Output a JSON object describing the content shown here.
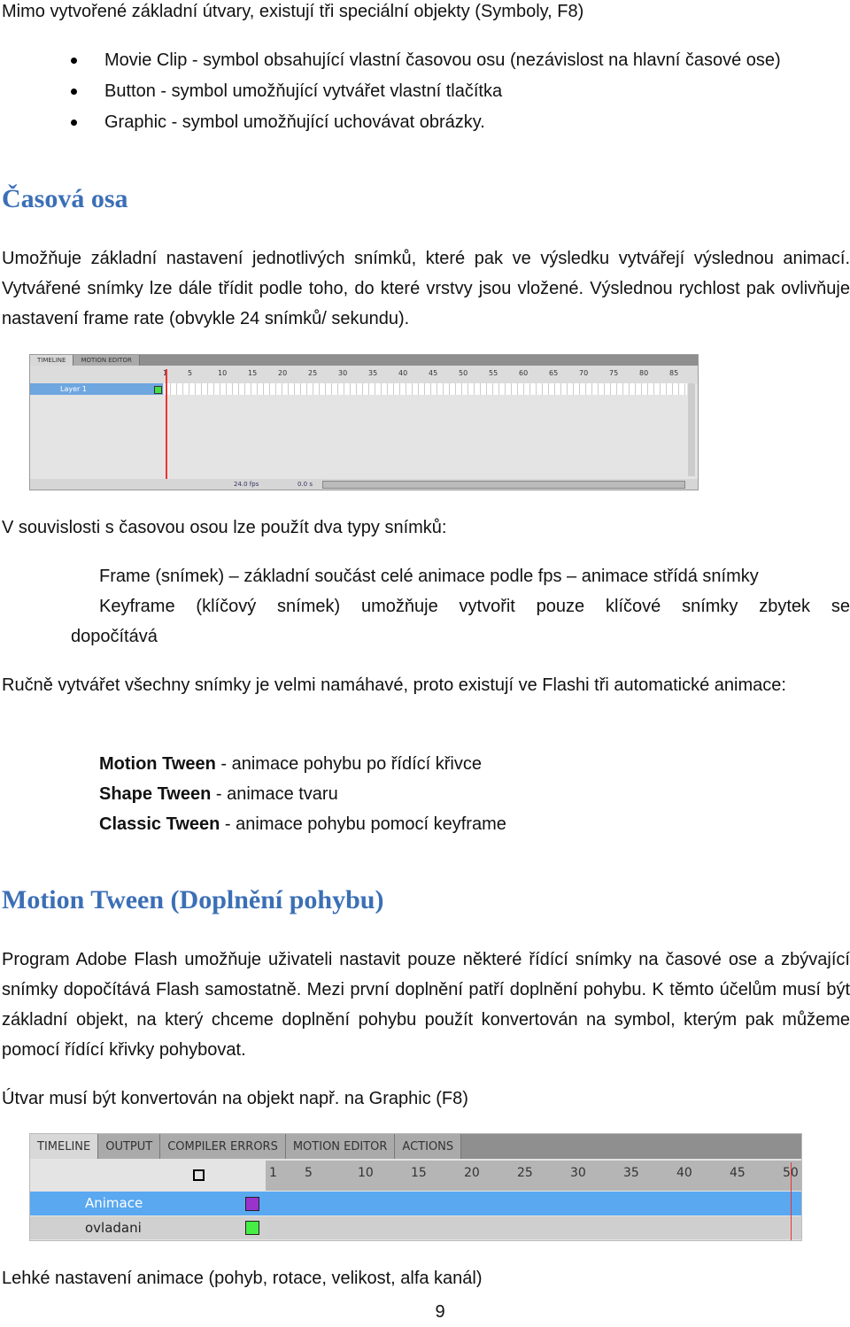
{
  "intro": "Mimo vytvořené základní útvary, existují tři speciální objekty (Symboly, F8)",
  "symbols": [
    "Movie Clip - symbol obsahující vlastní časovou osu (nezávislost na hlavní časové ose)",
    "Button - symbol umožňující vytvářet vlastní tlačítka",
    "Graphic  -  symbol umožňující uchovávat obrázky."
  ],
  "h1": "Časová osa",
  "p1": "Umožňuje základní nastavení jednotlivých snímků, které pak ve výsledku vytvářejí výslednou animací. Vytvářené snímky lze dále třídit podle toho, do které vrstvy jsou vložené. Výslednou rychlost pak ovlivňuje nastavení frame rate (obvykle 24 snímků/ sekundu).",
  "tl1": {
    "tabs": [
      "TIMELINE",
      "MOTION EDITOR"
    ],
    "frames": [
      "1",
      "5",
      "10",
      "15",
      "20",
      "25",
      "30",
      "35",
      "40",
      "45",
      "50",
      "55",
      "60",
      "65",
      "70",
      "75",
      "80",
      "85"
    ],
    "layer": "Layer 1",
    "fps": "24.0 fps",
    "time": "0.0 s",
    "frame": "1",
    "layer_color": "#44dd44"
  },
  "p2": "V souvislosti s časovou osou lze použít dva typy snímků:",
  "p3a": "Frame (snímek) – základní součást celé animace podle fps – animace střídá snímky",
  "p3b": "Keyframe (klíčový snímek) umožňuje vytvořit pouze klíčové snímky zbytek se",
  "p3c": "dopočítává",
  "p4": "Ručně vytvářet všechny snímky je velmi namáhavé, proto existují ve Flashi tři automatické animace:",
  "tweens": [
    {
      "name": "Motion Tween",
      "desc": " - animace pohybu po řídící křivce"
    },
    {
      "name": "Shape Tween",
      "desc": " - animace tvaru"
    },
    {
      "name": "Classic Tween",
      "desc": " - animace pohybu pomocí keyframe"
    }
  ],
  "h2": "Motion Tween (Doplnění pohybu)",
  "p5": "Program Adobe Flash umožňuje uživateli nastavit pouze některé řídící snímky na časové ose a zbývající snímky dopočítává Flash samostatně. Mezi první doplnění patří doplnění pohybu. K těmto účelům musí být základní objekt, na který chceme doplnění pohybu použít konvertován na symbol, kterým pak můžeme pomocí řídící křivky pohybovat.",
  "p6": "Útvar musí být konvertován na objekt např. na Graphic (F8)",
  "tl2": {
    "tabs": [
      "TIMELINE",
      "OUTPUT",
      "COMPILER ERRORS",
      "MOTION EDITOR",
      "ACTIONS"
    ],
    "frames": [
      "1",
      "5",
      "10",
      "15",
      "20",
      "25",
      "30",
      "35",
      "40",
      "45",
      "50"
    ],
    "layers": [
      {
        "name": "Animace",
        "color": "#9933cc"
      },
      {
        "name": "ovladani",
        "color": "#44ee44"
      }
    ],
    "selected_color": "#5aa8f0"
  },
  "p7": "Lehké nastavení animace (pohyb, rotace, velikost, alfa kanál)",
  "page": "9"
}
